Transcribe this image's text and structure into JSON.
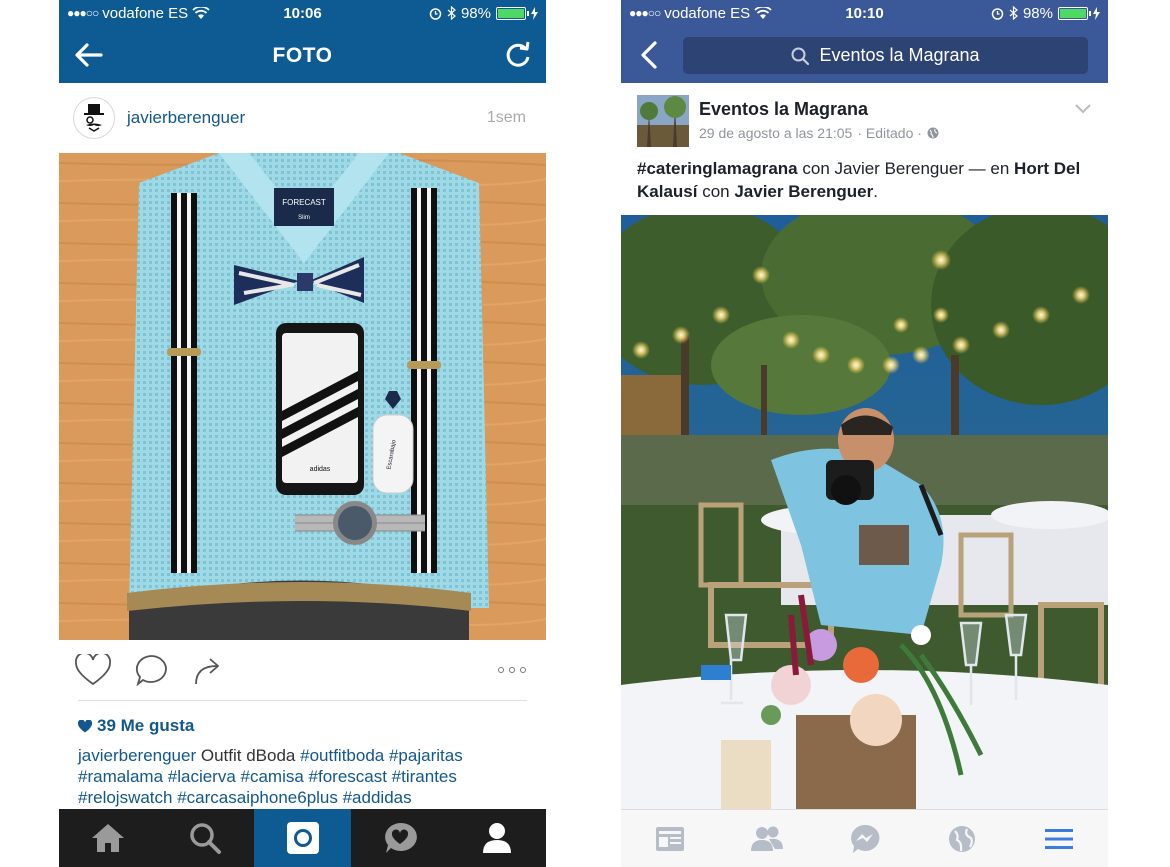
{
  "instagram": {
    "status": {
      "carrier": "vodafone ES",
      "time": "10:06",
      "battery": "98%"
    },
    "header": {
      "title": "FOTO"
    },
    "post": {
      "username": "javierberenguer",
      "time_ago": "1sem",
      "likes": "39 Me gusta",
      "caption_user": "javierberenguer",
      "caption_text": "Outfit dBoda",
      "hashtags_line1": "#outfitboda #pajaritas",
      "hashtags_line2": "#ramalama #lacierva #camisa #forescast #tirantes",
      "hashtags_line3": "#relojswatch #carcasaiphone6plus #addidas"
    },
    "photo_labels": {
      "shirt_brand": "FORECAST",
      "shirt_size": "Slim",
      "phone_brand": "adidas",
      "key_brand": "Escarabajo"
    },
    "tabs": [
      "home-icon",
      "search-icon",
      "camera-icon",
      "activity-icon",
      "profile-icon"
    ],
    "colors": {
      "bar": "#0e5a92",
      "link": "#12578d",
      "tabbar": "#1d1d1d"
    }
  },
  "facebook": {
    "status": {
      "carrier": "vodafone ES",
      "time": "10:10",
      "battery": "98%"
    },
    "search": {
      "query": "Eventos la Magrana"
    },
    "post": {
      "page_name": "Eventos la Magrana",
      "date": "29 de agosto a las 21:05",
      "edited": "· Editado ·",
      "hashtag": "#cateringlamagrana",
      "with1": " con Javier Berenguer — en ",
      "place": "Hort Del Kalausí",
      "with2": " con ",
      "person": "Javier Berenguer",
      "end": "."
    },
    "tabs": [
      "news-feed-icon",
      "friend-requests-icon",
      "messenger-icon",
      "notifications-globe-icon",
      "menu-icon"
    ],
    "colors": {
      "bar": "#3b5998",
      "search_field": "#2d4373",
      "active_tab": "#3b7ddd"
    }
  }
}
